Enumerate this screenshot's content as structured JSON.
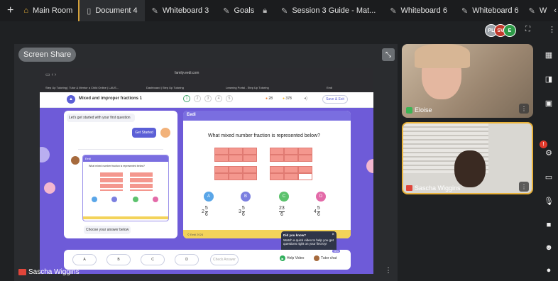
{
  "tabs": [
    {
      "icon": "home-icon",
      "label": "Main Room",
      "active": false
    },
    {
      "icon": "document-icon",
      "label": "Document 4",
      "active": true
    },
    {
      "icon": "whiteboard-icon",
      "label": "Whiteboard 3"
    },
    {
      "icon": "whiteboard-icon",
      "label": "Goals"
    },
    {
      "icon": "whiteboard-icon",
      "label": "Session 3 Guide - Mat..."
    },
    {
      "icon": "whiteboard-icon",
      "label": "Whiteboard 6"
    },
    {
      "icon": "whiteboard-icon",
      "label": "Whiteboard 6"
    },
    {
      "icon": "whiteboard-icon",
      "label": "W"
    }
  ],
  "participants": [
    {
      "initials": "PL",
      "color": "#9aa0a6"
    },
    {
      "initials": "SV",
      "color": "#c0392b"
    },
    {
      "initials": "E",
      "color": "#2e9b48"
    }
  ],
  "stage": {
    "screen_share_label": "Screen Share",
    "presenter_name": "Sascha Wiggins"
  },
  "browser": {
    "url": "family.eedi.com",
    "bookmarks": [
      "Step Up Tutoring | Tutor & Mentor a Child Online | LAUS...",
      "Dashboard | Step Up Tutoring",
      "Learning Portal - Step Up Tutoring",
      "Eedi"
    ]
  },
  "lesson": {
    "title": "Mixed and improper fractions 1",
    "steps": [
      "1",
      "2",
      "3",
      "4",
      "5"
    ],
    "streak": "28",
    "coins": "378",
    "save_exit": "Save & Exit",
    "chat_prompt": "Let's get started with your first question",
    "get_started": "Get Started",
    "choose_answer": "Choose your answer below",
    "brand": "Eedi",
    "question": "What mixed number fraction is represented below?",
    "options": [
      {
        "letter": "A",
        "color": "#5aa6e8",
        "whole": "2",
        "num": "5",
        "den": "6"
      },
      {
        "letter": "B",
        "color": "#7b7fe0",
        "whole": "3",
        "num": "5",
        "den": "6"
      },
      {
        "letter": "C",
        "color": "#5cc26d",
        "whole": "",
        "num": "23",
        "den": "6"
      },
      {
        "letter": "D",
        "color": "#e36aa8",
        "whole": "4",
        "num": "5",
        "den": "6"
      }
    ],
    "footer_note": "© Eedi 2024",
    "tooltip_title": "Did you know?",
    "tooltip_body": "Watch a quick video to help you get questions right on your first try!",
    "answer_buttons": [
      "A",
      "B",
      "C",
      "D"
    ],
    "check_answer": "Check Answer",
    "help_video": "Help Video",
    "tutor_chat": "Tutor chat",
    "new_badge": "New"
  },
  "videos": [
    {
      "name": "Eloise",
      "bg": "#b9a48e"
    },
    {
      "name": "Sascha Wiggins",
      "bg": "#d6d4cf"
    }
  ],
  "notifications": {
    "badge": "!"
  }
}
